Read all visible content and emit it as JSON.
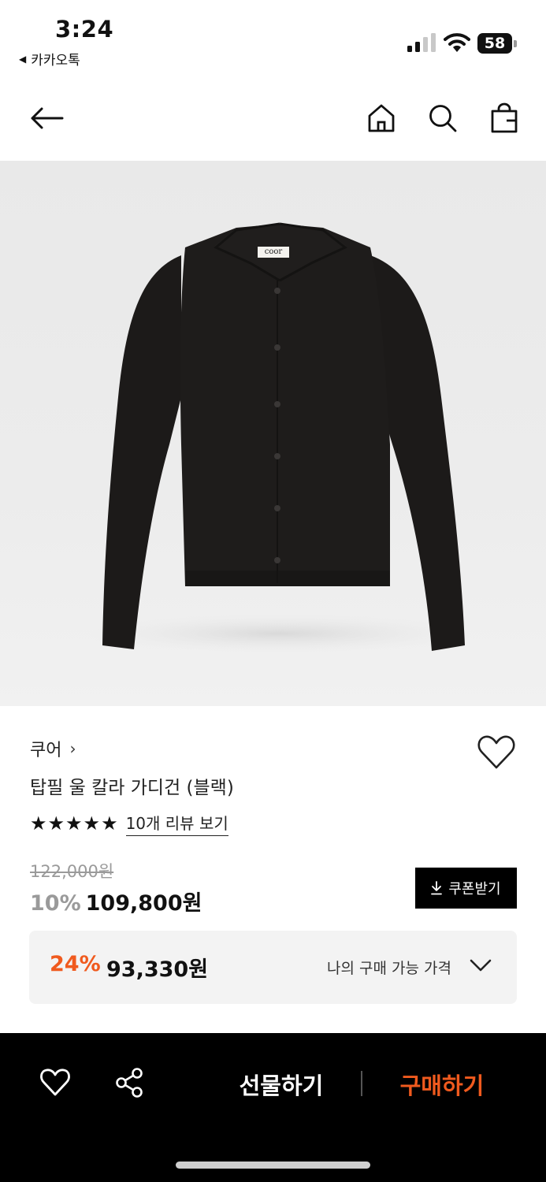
{
  "status_bar": {
    "time": "3:24",
    "back_app": "카카오톡",
    "battery_level": "58",
    "icons": [
      "cellular-signal-icon",
      "wifi-icon",
      "battery-icon"
    ]
  },
  "nav": {
    "icons": [
      "back-arrow-icon",
      "home-icon",
      "search-icon",
      "shopping-bag-icon"
    ]
  },
  "product_image": {
    "label_text": "coor"
  },
  "product": {
    "brand": "쿠어",
    "name": "탑필 울 칼라 가디건 (블랙)",
    "rating": 5,
    "review_link": "10개 리뷰 보기",
    "original_price": "122,000원",
    "discount_percent": "10%",
    "sale_price": "109,800원",
    "coupon_label": "쿠폰받기"
  },
  "my_price": {
    "discount_percent": "24%",
    "price": "93,330원",
    "label": "나의 구매 가능 가격"
  },
  "bottom_bar": {
    "gift_label": "선물하기",
    "buy_label": "구매하기",
    "icons": [
      "heart-icon",
      "share-icon"
    ]
  },
  "colors": {
    "accent": "#f05a1e",
    "black": "#000000",
    "muted": "#9a9a9a",
    "box_bg": "#f3f3f3"
  }
}
